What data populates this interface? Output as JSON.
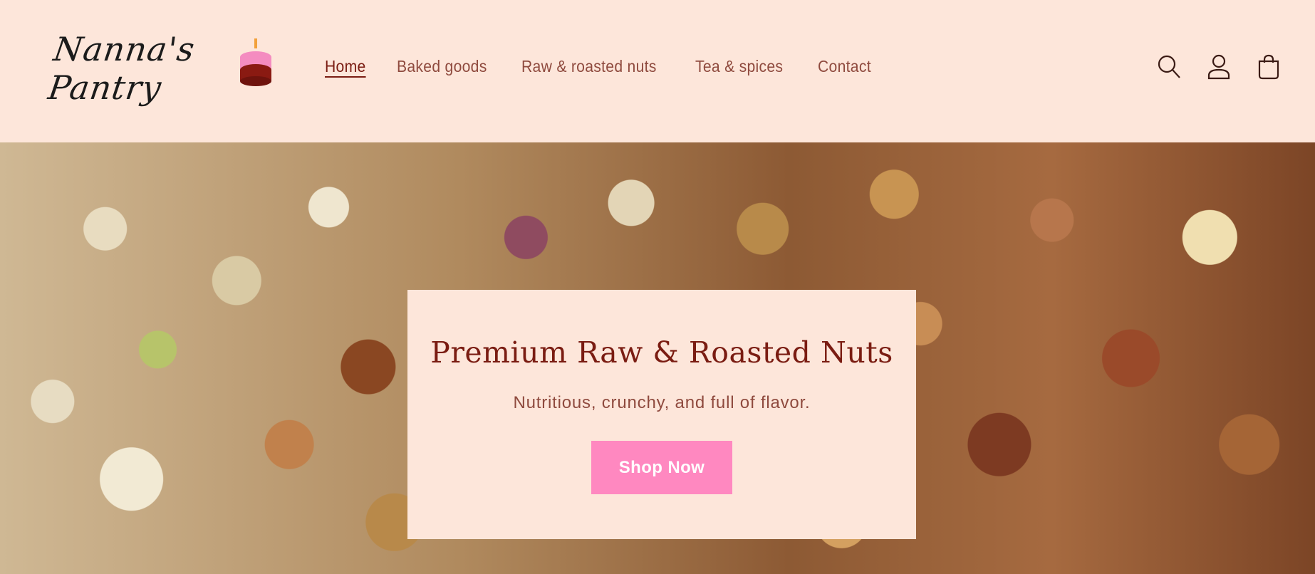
{
  "brand": {
    "logo_text": "Nanna's Pantry"
  },
  "nav": {
    "items": [
      {
        "label": "Home",
        "active": true
      },
      {
        "label": "Baked goods"
      },
      {
        "label": "Raw & roasted nuts"
      },
      {
        "label": "Tea & spices"
      },
      {
        "label": "Contact"
      }
    ]
  },
  "header_icons": [
    "search-icon",
    "account-icon",
    "cart-icon"
  ],
  "hero": {
    "title": "Premium Raw & Roasted Nuts",
    "subtitle": "Nutritious, crunchy, and full of flavor.",
    "cta_label": "Shop Now"
  },
  "colors": {
    "background": "#fde6da",
    "title": "#7a1c12",
    "nav_text": "#8f4a3e",
    "cta": "#ff88c0"
  }
}
